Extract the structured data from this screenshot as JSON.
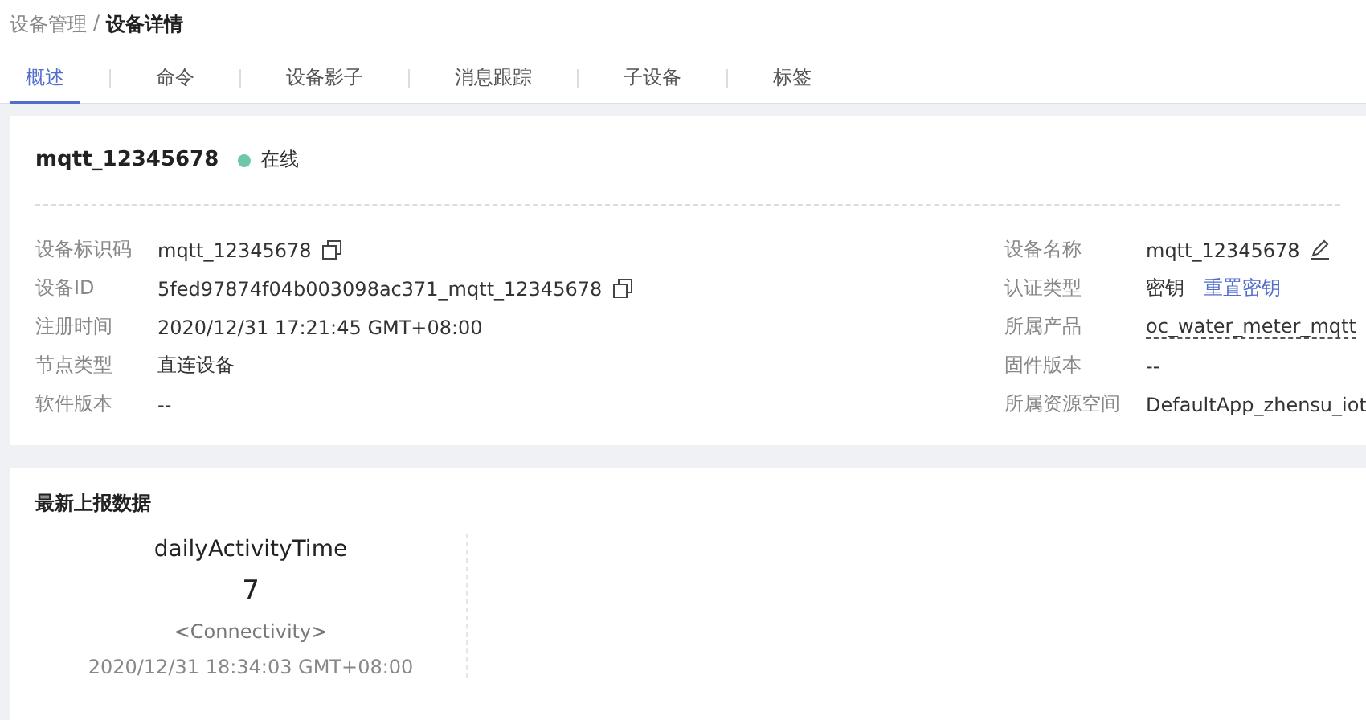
{
  "breadcrumb": {
    "parent": "设备管理",
    "separator": "/",
    "current": "设备详情"
  },
  "tabs": [
    {
      "label": "概述",
      "selected": true
    },
    {
      "label": "命令",
      "selected": false
    },
    {
      "label": "设备影子",
      "selected": false
    },
    {
      "label": "消息跟踪",
      "selected": false
    },
    {
      "label": "子设备",
      "selected": false
    },
    {
      "label": "标签",
      "selected": false
    }
  ],
  "device": {
    "name": "mqtt_12345678",
    "status": "在线",
    "online": true
  },
  "left_fields": [
    {
      "label": "设备标识码",
      "value": "mqtt_12345678",
      "kind": "copy"
    },
    {
      "label": "设备ID",
      "value": "5fed97874f04b003098ac371_mqtt_12345678",
      "kind": "copy"
    },
    {
      "label": "注册时间",
      "value": "2020/12/31 17:21:45 GMT+08:00",
      "kind": "plain"
    },
    {
      "label": "节点类型",
      "value": "直连设备",
      "kind": "plain"
    },
    {
      "label": "软件版本",
      "value": "--",
      "kind": "plain"
    }
  ],
  "right_fields": [
    {
      "label": "设备名称",
      "value": "mqtt_12345678",
      "kind": "edit"
    },
    {
      "label": "认证类型",
      "value": "密钥",
      "kind": "action",
      "action": "重置密钥"
    },
    {
      "label": "所属产品",
      "value": "oc_water_meter_mqtt",
      "kind": "underlined"
    },
    {
      "label": "固件版本",
      "value": "--",
      "kind": "plain"
    },
    {
      "label": "所属资源空间",
      "value": "DefaultApp_zhensu_iot",
      "kind": "plain"
    }
  ],
  "latest_data": {
    "title": "最新上报数据",
    "items": [
      {
        "property": "dailyActivityTime",
        "value": "7",
        "service": "<Connectivity>",
        "time": "2020/12/31 18:34:03 GMT+08:00"
      }
    ]
  }
}
